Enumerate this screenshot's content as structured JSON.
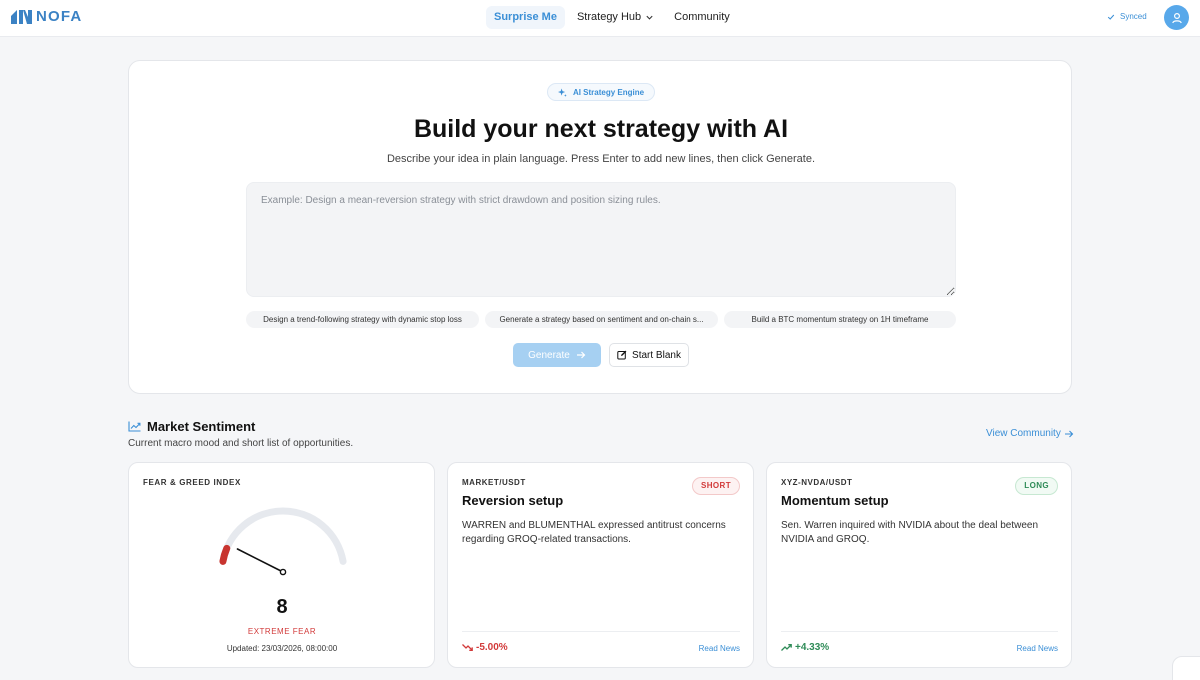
{
  "app": {
    "logo_text": "NOFA",
    "brand_color": "#3b82c4",
    "accent_color": "#3b8fd6"
  },
  "nav": {
    "items": [
      {
        "label": "Surprise Me",
        "active": true
      },
      {
        "label": "Strategy Hub",
        "has_dropdown": true
      },
      {
        "label": "Community"
      }
    ],
    "sync_status": "Synced",
    "avatar_icon": "user-icon"
  },
  "builder": {
    "badge": "AI Strategy Engine",
    "badge_icon": "sparkle-icon",
    "title": "Build your next strategy with AI",
    "subtitle": "Describe your idea in plain language. Press Enter to add new lines, then click Generate.",
    "prompt_value": "",
    "prompt_placeholder": "Example: Design a mean-reversion strategy with strict drawdown and position sizing rules.",
    "suggestions": [
      "Design a trend-following strategy with dynamic stop loss",
      "Generate a strategy based on sentiment and on-chain s...",
      "Build a BTC momentum strategy on 1H timeframe"
    ],
    "generate_label": "Generate",
    "generate_enabled": false,
    "blank_label": "Start Blank"
  },
  "sentiment": {
    "title": "Market Sentiment",
    "subtitle": "Current macro mood and short list of opportunities.",
    "view_link": "View Community",
    "fear_greed": {
      "label": "FEAR & GREED INDEX",
      "value": "8",
      "value_num": 8,
      "classification": "EXTREME FEAR",
      "updated": "Updated: 23/03/2026, 08:00:00",
      "level_color": "#c8342f",
      "track_color": "#e6e9ee"
    },
    "opportunities": [
      {
        "pair": "MARKET/USDT",
        "title": "Reversion setup",
        "side": "SHORT",
        "description": "WARREN and BLUMENTHAL expressed antitrust concerns regarding GROQ-related transactions.",
        "change": "-5.00%",
        "direction": "down",
        "link": "Read News"
      },
      {
        "pair": "XYZ-NVDA/USDT",
        "title": "Momentum setup",
        "side": "LONG",
        "description": "Sen. Warren inquired with NVIDIA about the deal between NVIDIA and GROQ.",
        "change": "+4.33%",
        "direction": "up",
        "link": "Read News"
      }
    ]
  }
}
